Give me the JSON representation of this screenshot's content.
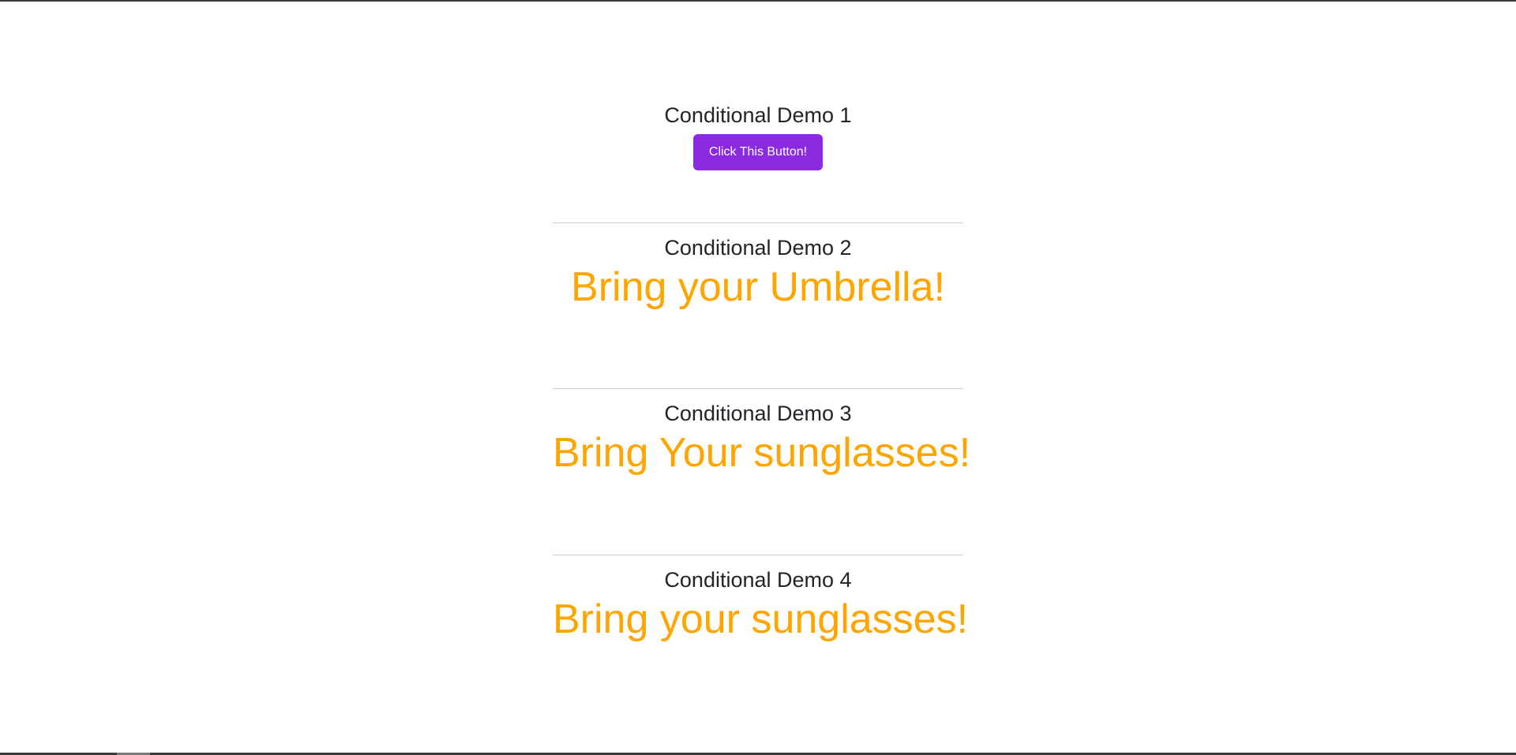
{
  "demos": [
    {
      "title": "Conditional Demo 1",
      "button_label": "Click This Button!"
    },
    {
      "title": "Conditional Demo 2",
      "message": "Bring your Umbrella!"
    },
    {
      "title": "Conditional Demo 3",
      "message": "Bring Your sunglasses!"
    },
    {
      "title": "Conditional Demo 4",
      "message": "Bring your sunglasses!"
    }
  ],
  "colors": {
    "button_bg": "#8a2be2",
    "message_text": "#ffa500",
    "title_text": "#212529",
    "divider": "#cfcfcf"
  }
}
